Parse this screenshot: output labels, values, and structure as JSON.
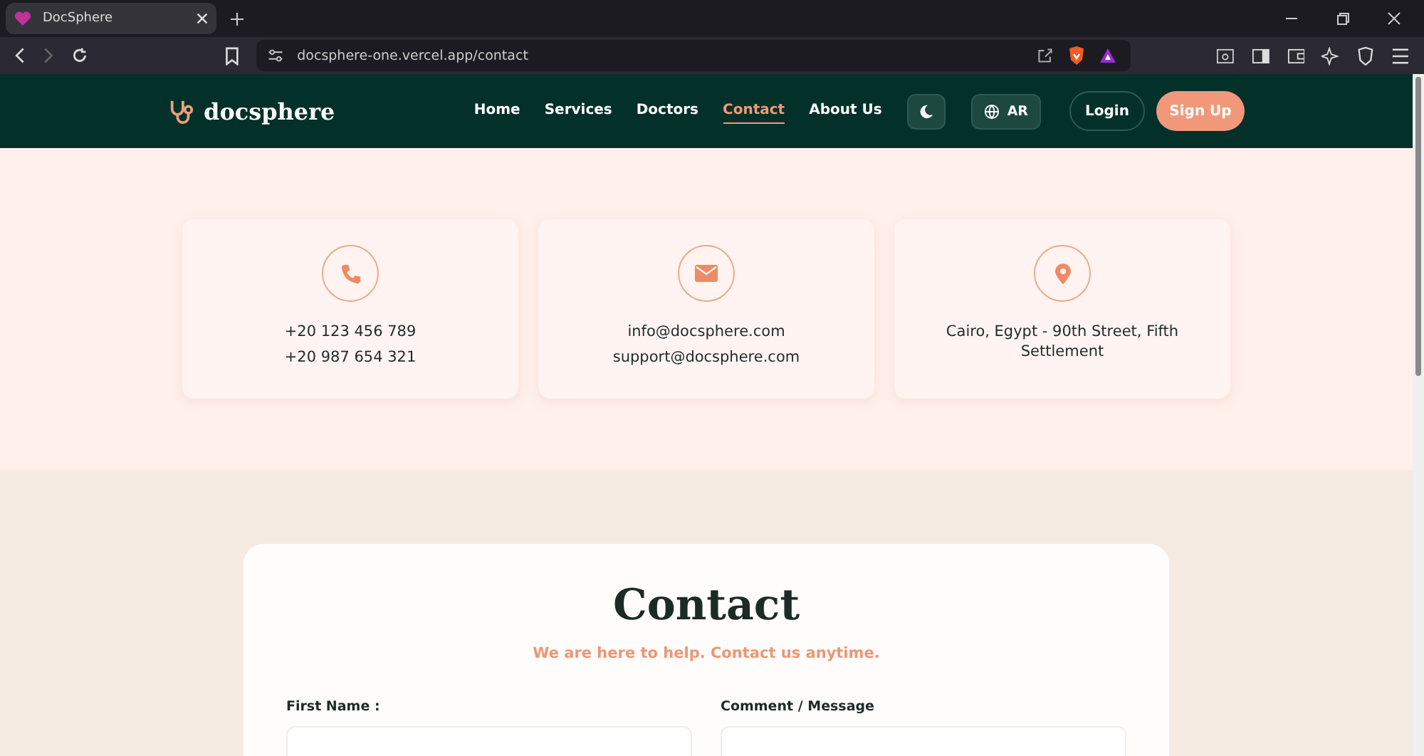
{
  "browser": {
    "tab_title": "DocSphere",
    "url": "docsphere-one.vercel.app/contact"
  },
  "nav": {
    "logo": "docsphere",
    "links": [
      {
        "label": "Home",
        "selected": false
      },
      {
        "label": "Services",
        "selected": false
      },
      {
        "label": "Doctors",
        "selected": false
      },
      {
        "label": "Contact",
        "selected": true
      },
      {
        "label": "About Us",
        "selected": false
      }
    ],
    "language": "AR",
    "login": "Login",
    "signup": "Sign Up"
  },
  "info_cards": [
    {
      "kind": "phone",
      "lines": [
        "+20 123 456 789",
        "+20 987 654 321"
      ]
    },
    {
      "kind": "email",
      "lines": [
        "info@docsphere.com",
        "support@docsphere.com"
      ]
    },
    {
      "kind": "location",
      "lines": [
        "Cairo, Egypt - 90th Street, Fifth Settlement"
      ]
    }
  ],
  "contact": {
    "title": "Contact",
    "subtitle": "We are here to help. Contact us anytime.",
    "fields": [
      {
        "label": "First Name :"
      },
      {
        "label": "Comment / Message"
      }
    ]
  }
}
